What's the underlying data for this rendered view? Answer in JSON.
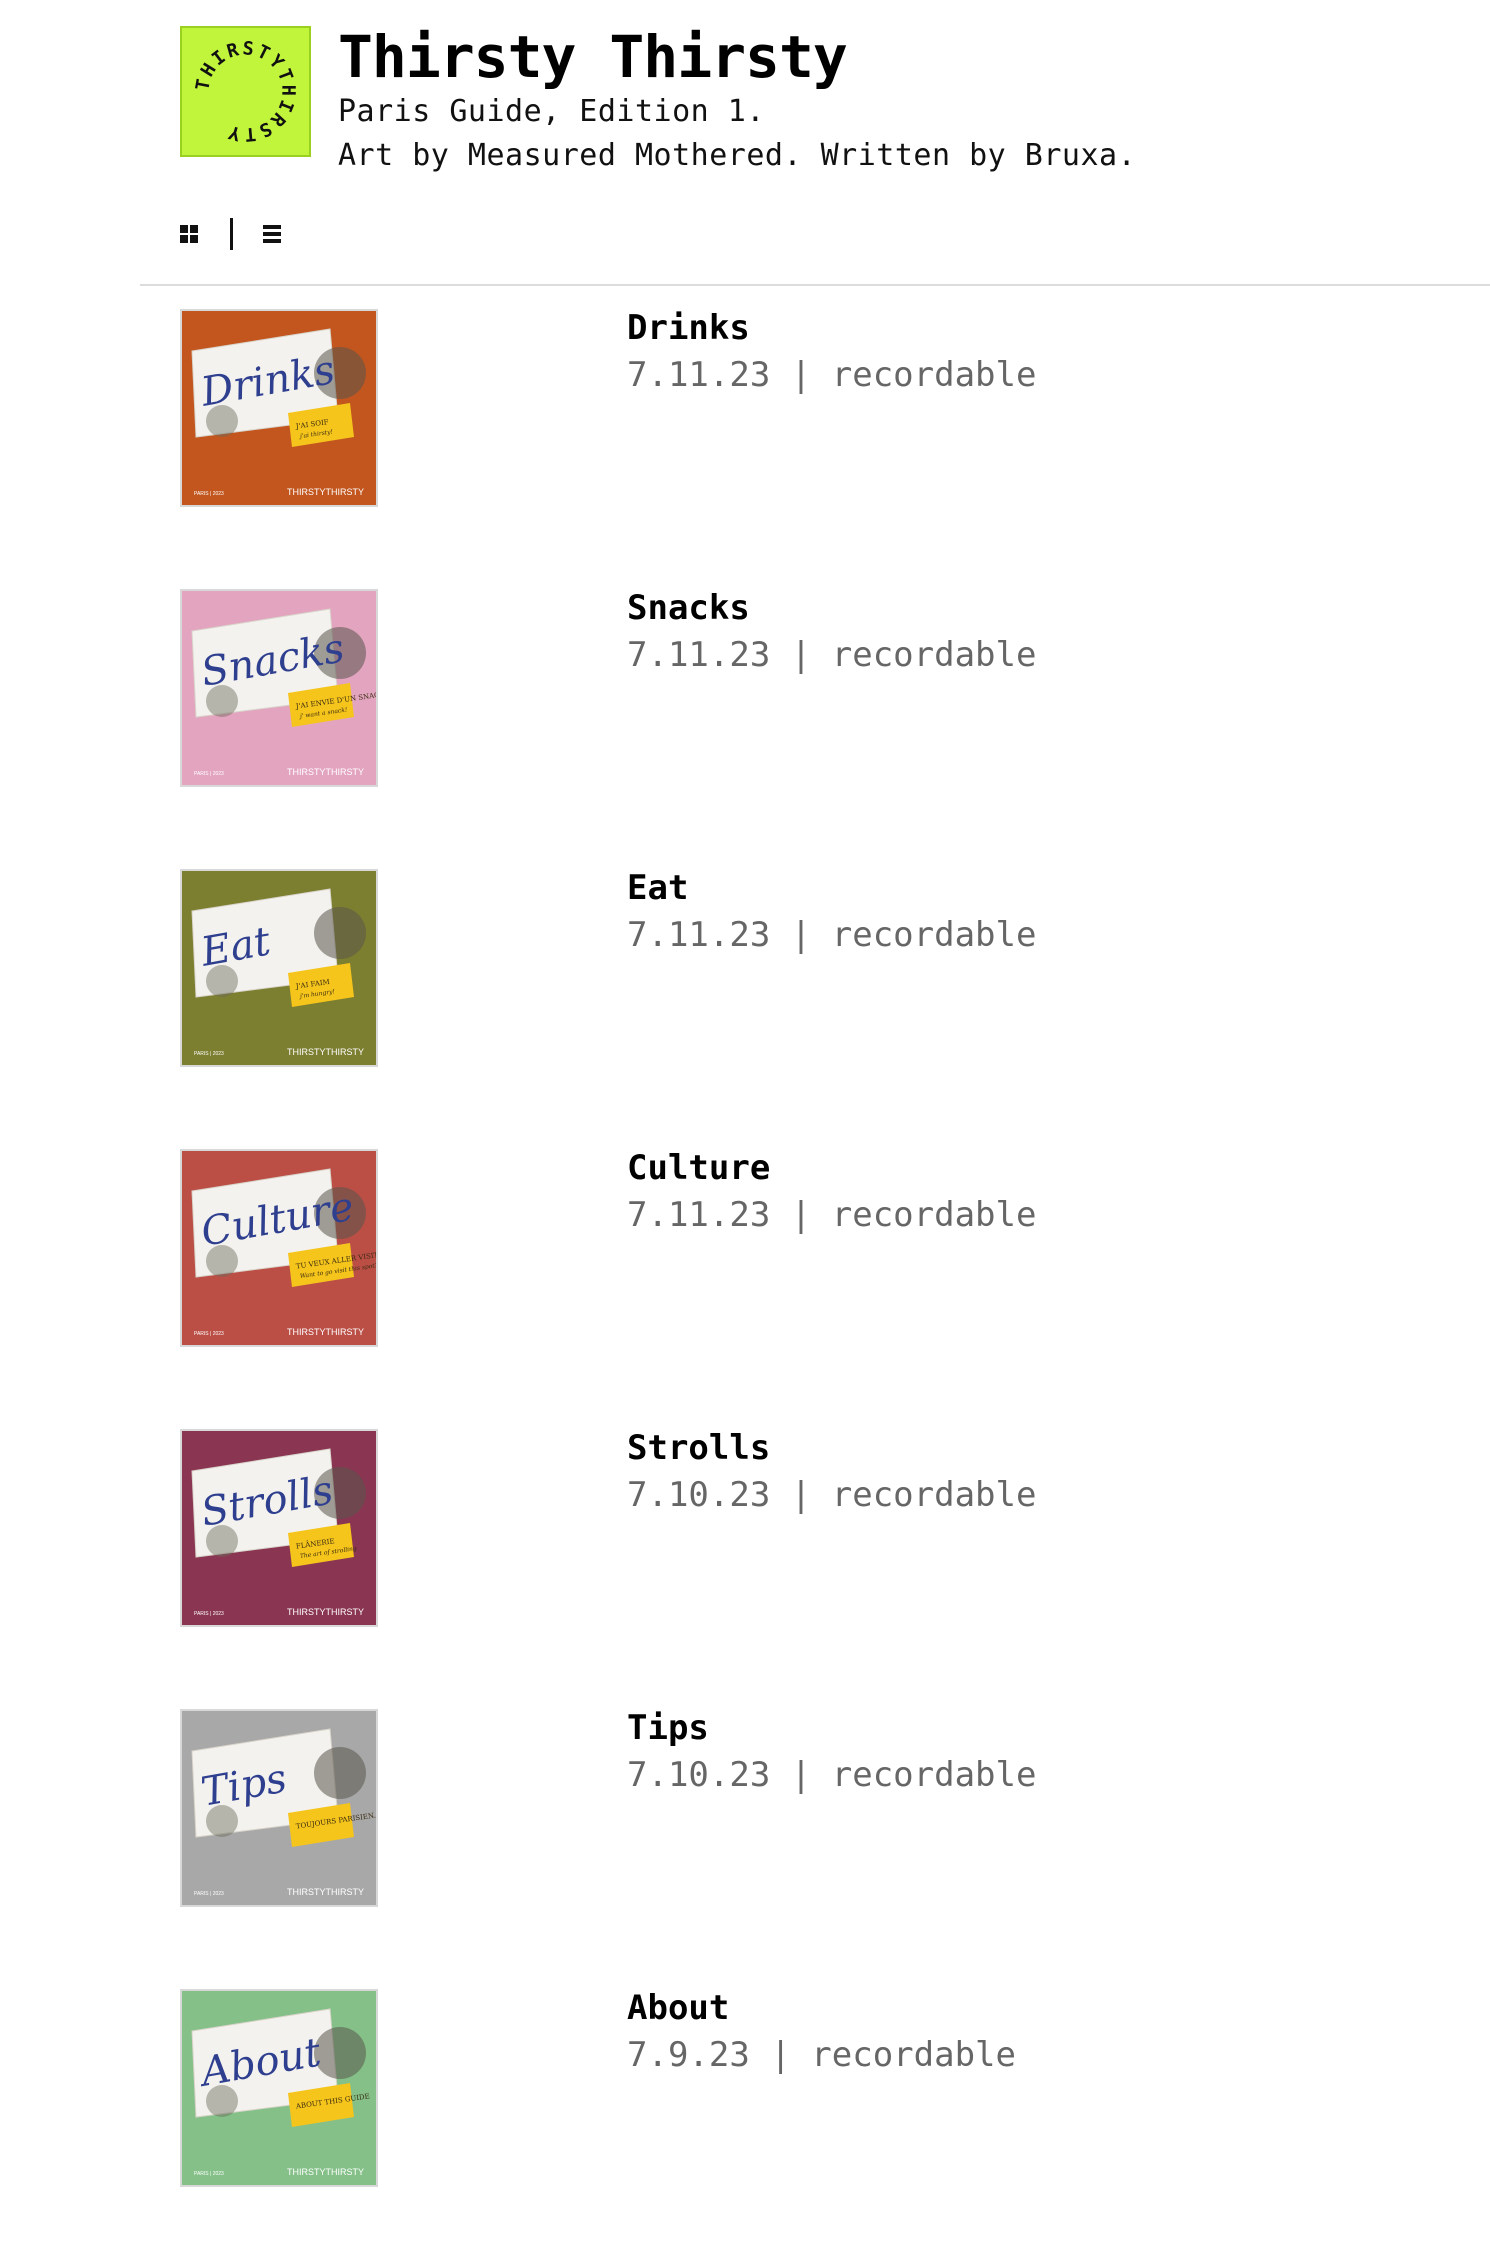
{
  "header": {
    "logo_text": "THIRSTYTHIRSTY",
    "logo_color": "#c1f53b",
    "title": "Thirsty Thirsty",
    "subtitle_line1": "Paris Guide, Edition 1.",
    "subtitle_line2": "Art by Measured Mothered. Written by Bruxa."
  },
  "view_toggle": {
    "grid_icon": "grid-icon",
    "separator": "|",
    "list_icon": "list-icon"
  },
  "items": [
    {
      "title": "Drinks",
      "date": "7.11.23",
      "separator": "|",
      "tag": "recordable",
      "thumb": {
        "script": "Drinks",
        "bg": "#c2561e",
        "sticker": "J'AI SOIF",
        "sticker_sub": "j'ai thirsty!",
        "footer_left": "PARIS | 2023",
        "footer_right": "THIRSTYTHIRSTY"
      }
    },
    {
      "title": "Snacks",
      "date": "7.11.23",
      "separator": "|",
      "tag": "recordable",
      "thumb": {
        "script": "Snacks",
        "bg": "#e3a4c0",
        "sticker": "J'AI ENVIE D'UN SNACK",
        "sticker_sub": "j' want a snack!",
        "footer_left": "PARIS | 2023",
        "footer_right": "THIRSTYTHIRSTY"
      }
    },
    {
      "title": "Eat",
      "date": "7.11.23",
      "separator": "|",
      "tag": "recordable",
      "thumb": {
        "script": "Eat",
        "bg": "#7c7e30",
        "sticker": "J'AI FAIM",
        "sticker_sub": "j'm hungry!",
        "footer_left": "PARIS | 2023",
        "footer_right": "THIRSTYTHIRSTY"
      }
    },
    {
      "title": "Culture",
      "date": "7.11.23",
      "separator": "|",
      "tag": "recordable",
      "thumb": {
        "script": "Culture",
        "bg": "#bb4f46",
        "sticker": "TU VEUX ALLER VISITER UN SPOT?",
        "sticker_sub": "Want to go visit this spot?",
        "footer_left": "PARIS | 2023",
        "footer_right": "THIRSTYTHIRSTY"
      }
    },
    {
      "title": "Strolls",
      "date": "7.10.23",
      "separator": "|",
      "tag": "recordable",
      "thumb": {
        "script": "Strolls",
        "bg": "#8a3552",
        "sticker": "FLÂNERIE",
        "sticker_sub": "The art of strolling",
        "footer_left": "PARIS | 2023",
        "footer_right": "THIRSTYTHIRSTY"
      }
    },
    {
      "title": "Tips",
      "date": "7.10.23",
      "separator": "|",
      "tag": "recordable",
      "thumb": {
        "script": "Tips",
        "bg": "#a8a8a8",
        "sticker": "TOUJOURS PARISIEN.OO",
        "sticker_sub": "",
        "footer_left": "PARIS | 2023",
        "footer_right": "THIRSTYTHIRSTY"
      }
    },
    {
      "title": "About",
      "date": "7.9.23",
      "separator": "|",
      "tag": "recordable",
      "thumb": {
        "script": "About",
        "bg": "#84c088",
        "sticker": "ABOUT THIS GUIDE",
        "sticker_sub": "",
        "footer_left": "PARIS | 2023",
        "footer_right": "THIRSTYTHIRSTY"
      }
    }
  ]
}
